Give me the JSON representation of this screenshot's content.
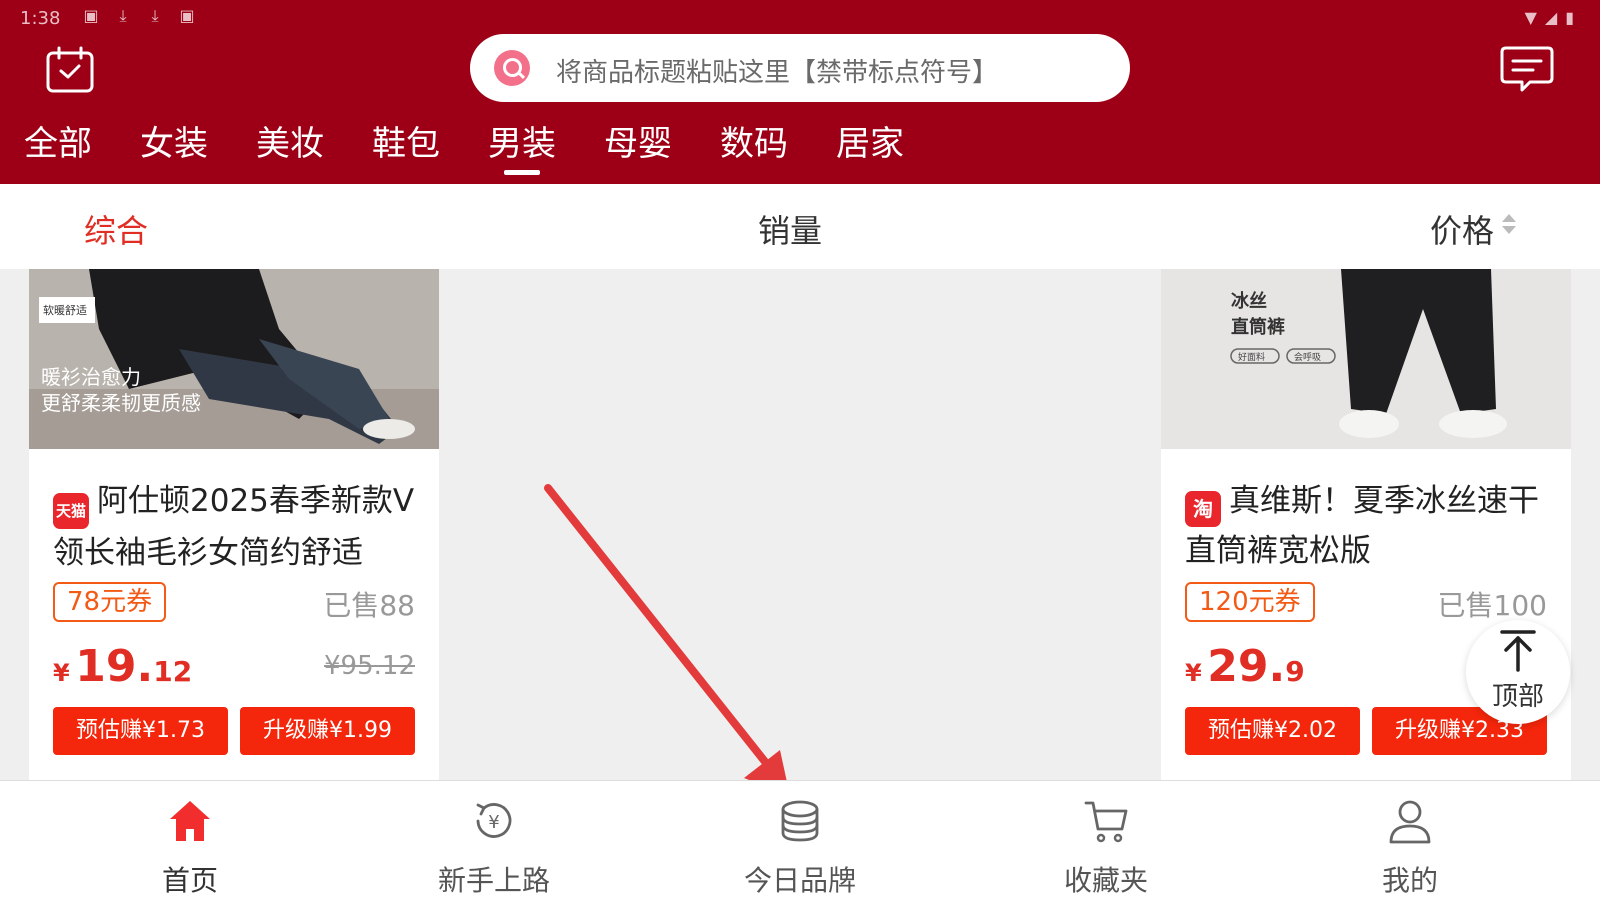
{
  "status_bar": {
    "time": "1:38"
  },
  "search": {
    "placeholder": "将商品标题粘贴这里【禁带标点符号】"
  },
  "categories": [
    "全部",
    "女装",
    "美妆",
    "鞋包",
    "男装",
    "母婴",
    "数码",
    "居家"
  ],
  "active_category": "男装",
  "sort": {
    "items": [
      "综合",
      "销量",
      "价格"
    ],
    "active": "综合"
  },
  "products": [
    {
      "image_text": [
        "软暖舒适",
        "暖衫治愈力",
        "更舒柔柔韧更质感"
      ],
      "shop_badge": "天猫",
      "title": "阿仕顿2025春季新款V领长袖毛衫女简约舒适",
      "coupon": "78元券",
      "sold": "已售88",
      "price_currency": "¥",
      "price_int": "19.",
      "price_dec": "12",
      "original_price": "¥95.12",
      "earn_estimate": "预估赚¥1.73",
      "earn_upgrade": "升级赚¥1.99"
    },
    {
      "image_text": [
        "冰丝",
        "直筒裤",
        "好面料",
        "会呼吸"
      ],
      "shop_badge": "淘",
      "title": "真维斯！夏季冰丝速干直筒裤宽松版",
      "coupon": "120元券",
      "sold": "已售100",
      "price_currency": "¥",
      "price_int": "29.",
      "price_dec": "9",
      "earn_estimate": "预估赚¥2.02",
      "earn_upgrade": "升级赚¥2.33"
    }
  ],
  "back_to_top": "顶部",
  "bottom_nav": [
    {
      "label": "首页",
      "icon": "home-icon",
      "active": true
    },
    {
      "label": "新手上路",
      "icon": "yen-refresh-icon",
      "active": false
    },
    {
      "label": "今日品牌",
      "icon": "coins-stack-icon",
      "active": false
    },
    {
      "label": "收藏夹",
      "icon": "cart-icon",
      "active": false
    },
    {
      "label": "我的",
      "icon": "user-icon",
      "active": false
    }
  ],
  "colors": {
    "header_bg": "#9d0016",
    "accent": "#e02e24",
    "earn_button": "#f4260b",
    "coupon": "#f25a16",
    "annotation": "#e33b3b"
  }
}
